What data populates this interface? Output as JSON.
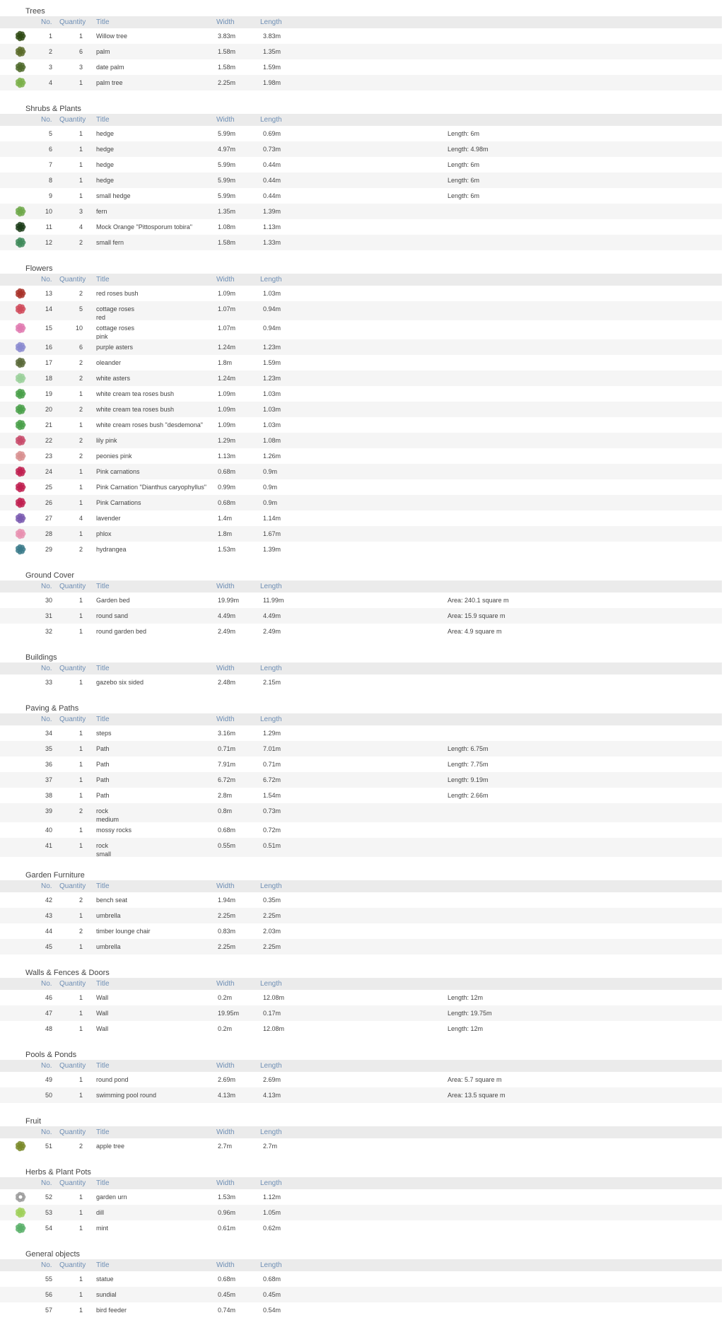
{
  "columns": {
    "no": "No.",
    "qty": "Quantity",
    "title": "Title",
    "width": "Width",
    "length": "Length"
  },
  "sections": [
    {
      "name": "Trees",
      "rows": [
        {
          "no": "1",
          "qty": "1",
          "title": "Willow tree",
          "sub": "",
          "width": "3.83m",
          "length": "3.83m",
          "notes": "",
          "icon": "willow-tree-icon",
          "color": "#2f4a14"
        },
        {
          "no": "2",
          "qty": "6",
          "title": "palm",
          "sub": "",
          "width": "1.58m",
          "length": "1.35m",
          "notes": "",
          "icon": "palm-icon",
          "color": "#5b6b2a"
        },
        {
          "no": "3",
          "qty": "3",
          "title": "date palm",
          "sub": "",
          "width": "1.58m",
          "length": "1.59m",
          "notes": "",
          "icon": "date-palm-icon",
          "color": "#4f6a2c"
        },
        {
          "no": "4",
          "qty": "1",
          "title": "palm tree",
          "sub": "",
          "width": "2.25m",
          "length": "1.98m",
          "notes": "",
          "icon": "palm-tree-icon",
          "color": "#7bb04a"
        }
      ]
    },
    {
      "name": "Shrubs & Plants",
      "rows": [
        {
          "no": "5",
          "qty": "1",
          "title": "hedge",
          "sub": "",
          "width": "5.99m",
          "length": "0.69m",
          "notes": "Length: 6m",
          "icon": "",
          "color": ""
        },
        {
          "no": "6",
          "qty": "1",
          "title": "hedge",
          "sub": "",
          "width": "4.97m",
          "length": "0.73m",
          "notes": "Length: 4.98m",
          "icon": "",
          "color": ""
        },
        {
          "no": "7",
          "qty": "1",
          "title": "hedge",
          "sub": "",
          "width": "5.99m",
          "length": "0.44m",
          "notes": "Length: 6m",
          "icon": "",
          "color": ""
        },
        {
          "no": "8",
          "qty": "1",
          "title": "hedge",
          "sub": "",
          "width": "5.99m",
          "length": "0.44m",
          "notes": "Length: 6m",
          "icon": "",
          "color": ""
        },
        {
          "no": "9",
          "qty": "1",
          "title": "small hedge",
          "sub": "",
          "width": "5.99m",
          "length": "0.44m",
          "notes": "Length: 6m",
          "icon": "",
          "color": ""
        },
        {
          "no": "10",
          "qty": "3",
          "title": "fern",
          "sub": "",
          "width": "1.35m",
          "length": "1.39m",
          "notes": "",
          "icon": "fern-icon",
          "color": "#6fa84a"
        },
        {
          "no": "11",
          "qty": "4",
          "title": "Mock Orange \"Pittosporum tobira\"",
          "sub": "",
          "width": "1.08m",
          "length": "1.13m",
          "notes": "",
          "icon": "mock-orange-icon",
          "color": "#1d3d1a"
        },
        {
          "no": "12",
          "qty": "2",
          "title": "small fern",
          "sub": "",
          "width": "1.58m",
          "length": "1.33m",
          "notes": "",
          "icon": "small-fern-icon",
          "color": "#3f8a5a"
        }
      ]
    },
    {
      "name": "Flowers",
      "rows": [
        {
          "no": "13",
          "qty": "2",
          "title": "red roses bush",
          "sub": "",
          "width": "1.09m",
          "length": "1.03m",
          "notes": "",
          "icon": "red-roses-icon",
          "color": "#a8322a"
        },
        {
          "no": "14",
          "qty": "5",
          "title": "cottage roses",
          "sub": "red",
          "width": "1.07m",
          "length": "0.94m",
          "notes": "",
          "icon": "cottage-roses-red-icon",
          "color": "#d04a5a"
        },
        {
          "no": "15",
          "qty": "10",
          "title": "cottage roses",
          "sub": "pink",
          "width": "1.07m",
          "length": "0.94m",
          "notes": "",
          "icon": "cottage-roses-pink-icon",
          "color": "#e07ab0"
        },
        {
          "no": "16",
          "qty": "6",
          "title": "purple asters",
          "sub": "",
          "width": "1.24m",
          "length": "1.23m",
          "notes": "",
          "icon": "purple-asters-icon",
          "color": "#8a8ad0"
        },
        {
          "no": "17",
          "qty": "2",
          "title": "oleander",
          "sub": "",
          "width": "1.8m",
          "length": "1.59m",
          "notes": "",
          "icon": "oleander-icon",
          "color": "#5a6a3a"
        },
        {
          "no": "18",
          "qty": "2",
          "title": "white asters",
          "sub": "",
          "width": "1.24m",
          "length": "1.23m",
          "notes": "",
          "icon": "white-asters-icon",
          "color": "#9ad09a"
        },
        {
          "no": "19",
          "qty": "1",
          "title": "white cream tea roses bush",
          "sub": "",
          "width": "1.09m",
          "length": "1.03m",
          "notes": "",
          "icon": "white-tea-roses-icon",
          "color": "#4aa04a"
        },
        {
          "no": "20",
          "qty": "2",
          "title": "white cream tea roses bush",
          "sub": "",
          "width": "1.09m",
          "length": "1.03m",
          "notes": "",
          "icon": "white-tea-roses-icon-2",
          "color": "#4aa04a"
        },
        {
          "no": "21",
          "qty": "1",
          "title": "white cream roses bush \"desdemona\"",
          "sub": "",
          "width": "1.09m",
          "length": "1.03m",
          "notes": "",
          "icon": "desdemona-roses-icon",
          "color": "#4aa04a"
        },
        {
          "no": "22",
          "qty": "2",
          "title": "lily pink",
          "sub": "",
          "width": "1.29m",
          "length": "1.08m",
          "notes": "",
          "icon": "lily-pink-icon",
          "color": "#c84a6a"
        },
        {
          "no": "23",
          "qty": "2",
          "title": "peonies pink",
          "sub": "",
          "width": "1.13m",
          "length": "1.26m",
          "notes": "",
          "icon": "peonies-pink-icon",
          "color": "#d89090"
        },
        {
          "no": "24",
          "qty": "1",
          "title": "Pink carnations",
          "sub": "",
          "width": "0.68m",
          "length": "0.9m",
          "notes": "",
          "icon": "pink-carnations-icon",
          "color": "#c02050"
        },
        {
          "no": "25",
          "qty": "1",
          "title": "Pink Carnation \"Dianthus caryophyllus\"",
          "sub": "",
          "width": "0.99m",
          "length": "0.9m",
          "notes": "",
          "icon": "dianthus-icon",
          "color": "#c02050"
        },
        {
          "no": "26",
          "qty": "1",
          "title": "Pink Carnations",
          "sub": "",
          "width": "0.68m",
          "length": "0.9m",
          "notes": "",
          "icon": "pink-carnations-icon-2",
          "color": "#c02050"
        },
        {
          "no": "27",
          "qty": "4",
          "title": "lavender",
          "sub": "",
          "width": "1.4m",
          "length": "1.14m",
          "notes": "",
          "icon": "lavender-icon",
          "color": "#7a5ab0"
        },
        {
          "no": "28",
          "qty": "1",
          "title": "phlox",
          "sub": "",
          "width": "1.8m",
          "length": "1.67m",
          "notes": "",
          "icon": "phlox-icon",
          "color": "#e890b0"
        },
        {
          "no": "29",
          "qty": "2",
          "title": "hydrangea",
          "sub": "",
          "width": "1.53m",
          "length": "1.39m",
          "notes": "",
          "icon": "hydrangea-icon",
          "color": "#3a7a8a"
        }
      ]
    },
    {
      "name": "Ground Cover",
      "rows": [
        {
          "no": "30",
          "qty": "1",
          "title": "Garden bed",
          "sub": "",
          "width": "19.99m",
          "length": "11.99m",
          "notes": "Area: 240.1 square m",
          "icon": "",
          "color": ""
        },
        {
          "no": "31",
          "qty": "1",
          "title": "round sand",
          "sub": "",
          "width": "4.49m",
          "length": "4.49m",
          "notes": "Area: 15.9 square m",
          "icon": "",
          "color": ""
        },
        {
          "no": "32",
          "qty": "1",
          "title": "round garden bed",
          "sub": "",
          "width": "2.49m",
          "length": "2.49m",
          "notes": "Area: 4.9 square m",
          "icon": "",
          "color": ""
        }
      ]
    },
    {
      "name": "Buildings",
      "rows": [
        {
          "no": "33",
          "qty": "1",
          "title": "gazebo six sided",
          "sub": "",
          "width": "2.48m",
          "length": "2.15m",
          "notes": "",
          "icon": "",
          "color": ""
        }
      ]
    },
    {
      "name": "Paving & Paths",
      "rows": [
        {
          "no": "34",
          "qty": "1",
          "title": "steps",
          "sub": "",
          "width": "3.16m",
          "length": "1.29m",
          "notes": "",
          "icon": "",
          "color": ""
        },
        {
          "no": "35",
          "qty": "1",
          "title": "Path",
          "sub": "",
          "width": "0.71m",
          "length": "7.01m",
          "notes": "Length: 6.75m",
          "icon": "",
          "color": ""
        },
        {
          "no": "36",
          "qty": "1",
          "title": "Path",
          "sub": "",
          "width": "7.91m",
          "length": "0.71m",
          "notes": "Length: 7.75m",
          "icon": "",
          "color": ""
        },
        {
          "no": "37",
          "qty": "1",
          "title": "Path",
          "sub": "",
          "width": "6.72m",
          "length": "6.72m",
          "notes": "Length: 9.19m",
          "icon": "",
          "color": ""
        },
        {
          "no": "38",
          "qty": "1",
          "title": "Path",
          "sub": "",
          "width": "2.8m",
          "length": "1.54m",
          "notes": "Length: 2.66m",
          "icon": "",
          "color": ""
        },
        {
          "no": "39",
          "qty": "2",
          "title": "rock",
          "sub": "medium",
          "width": "0.8m",
          "length": "0.73m",
          "notes": "",
          "icon": "",
          "color": ""
        },
        {
          "no": "40",
          "qty": "1",
          "title": "mossy rocks",
          "sub": "",
          "width": "0.68m",
          "length": "0.72m",
          "notes": "",
          "icon": "",
          "color": ""
        },
        {
          "no": "41",
          "qty": "1",
          "title": "rock",
          "sub": "small",
          "width": "0.55m",
          "length": "0.51m",
          "notes": "",
          "icon": "",
          "color": ""
        }
      ]
    },
    {
      "name": "Garden Furniture",
      "rows": [
        {
          "no": "42",
          "qty": "2",
          "title": "bench seat",
          "sub": "",
          "width": "1.94m",
          "length": "0.35m",
          "notes": "",
          "icon": "",
          "color": ""
        },
        {
          "no": "43",
          "qty": "1",
          "title": "umbrella",
          "sub": "",
          "width": "2.25m",
          "length": "2.25m",
          "notes": "",
          "icon": "",
          "color": ""
        },
        {
          "no": "44",
          "qty": "2",
          "title": "timber lounge chair",
          "sub": "",
          "width": "0.83m",
          "length": "2.03m",
          "notes": "",
          "icon": "",
          "color": ""
        },
        {
          "no": "45",
          "qty": "1",
          "title": "umbrella",
          "sub": "",
          "width": "2.25m",
          "length": "2.25m",
          "notes": "",
          "icon": "",
          "color": ""
        }
      ]
    },
    {
      "name": "Walls & Fences & Doors",
      "rows": [
        {
          "no": "46",
          "qty": "1",
          "title": "Wall",
          "sub": "",
          "width": "0.2m",
          "length": "12.08m",
          "notes": "Length: 12m",
          "icon": "",
          "color": ""
        },
        {
          "no": "47",
          "qty": "1",
          "title": "Wall",
          "sub": "",
          "width": "19.95m",
          "length": "0.17m",
          "notes": "Length: 19.75m",
          "icon": "",
          "color": ""
        },
        {
          "no": "48",
          "qty": "1",
          "title": "Wall",
          "sub": "",
          "width": "0.2m",
          "length": "12.08m",
          "notes": "Length: 12m",
          "icon": "",
          "color": ""
        }
      ]
    },
    {
      "name": "Pools & Ponds",
      "rows": [
        {
          "no": "49",
          "qty": "1",
          "title": "round pond",
          "sub": "",
          "width": "2.69m",
          "length": "2.69m",
          "notes": "Area: 5.7 square m",
          "icon": "",
          "color": ""
        },
        {
          "no": "50",
          "qty": "1",
          "title": "swimming pool round",
          "sub": "",
          "width": "4.13m",
          "length": "4.13m",
          "notes": "Area: 13.5 square m",
          "icon": "",
          "color": ""
        }
      ]
    },
    {
      "name": "Fruit",
      "rows": [
        {
          "no": "51",
          "qty": "2",
          "title": "apple tree",
          "sub": "",
          "width": "2.7m",
          "length": "2.7m",
          "notes": "",
          "icon": "apple-tree-icon",
          "color": "#7a8a2a"
        }
      ]
    },
    {
      "name": "Herbs & Plant Pots",
      "rows": [
        {
          "no": "52",
          "qty": "1",
          "title": "garden urn",
          "sub": "",
          "width": "1.53m",
          "length": "1.12m",
          "notes": "",
          "icon": "garden-urn-icon",
          "color": "#9a9a9a"
        },
        {
          "no": "53",
          "qty": "1",
          "title": "dill",
          "sub": "",
          "width": "0.96m",
          "length": "1.05m",
          "notes": "",
          "icon": "dill-icon",
          "color": "#a0d05a"
        },
        {
          "no": "54",
          "qty": "1",
          "title": "mint",
          "sub": "",
          "width": "0.61m",
          "length": "0.62m",
          "notes": "",
          "icon": "mint-icon",
          "color": "#5ab06a"
        }
      ]
    },
    {
      "name": "General objects",
      "rows": [
        {
          "no": "55",
          "qty": "1",
          "title": "statue",
          "sub": "",
          "width": "0.68m",
          "length": "0.68m",
          "notes": "",
          "icon": "",
          "color": ""
        },
        {
          "no": "56",
          "qty": "1",
          "title": "sundial",
          "sub": "",
          "width": "0.45m",
          "length": "0.45m",
          "notes": "",
          "icon": "",
          "color": ""
        },
        {
          "no": "57",
          "qty": "1",
          "title": "bird feeder",
          "sub": "",
          "width": "0.74m",
          "length": "0.54m",
          "notes": "",
          "icon": "",
          "color": ""
        }
      ]
    }
  ]
}
